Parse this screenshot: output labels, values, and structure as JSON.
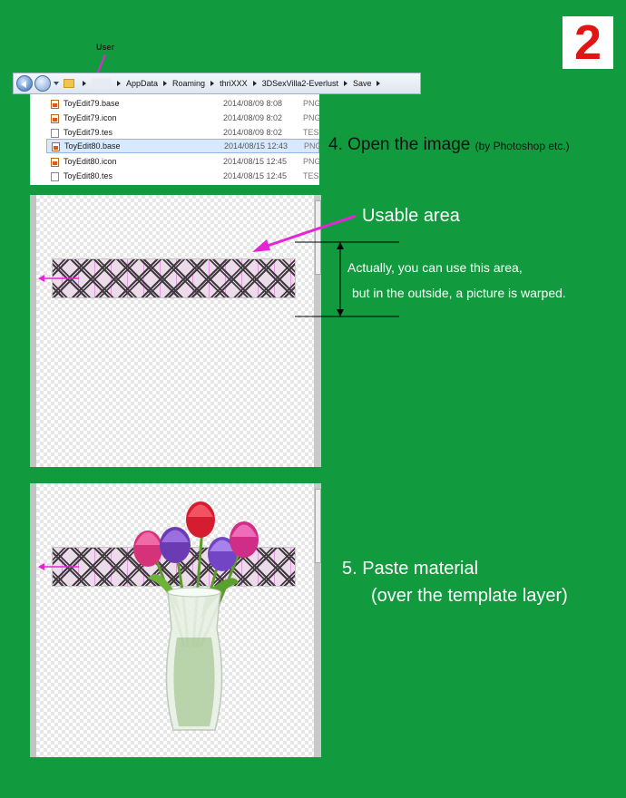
{
  "badge": "2",
  "user_label": "User",
  "breadcrumb": [
    "AppData",
    "Roaming",
    "thriXXX",
    "3DSexVilla2-Everlust",
    "Save"
  ],
  "files": [
    {
      "name": "ToyEdit79.base",
      "date": "2014/08/09 8:08",
      "type": "PNG",
      "icon": "image-file-icon",
      "selected": false
    },
    {
      "name": "ToyEdit79.icon",
      "date": "2014/08/09 8:02",
      "type": "PNG",
      "icon": "image-file-icon",
      "selected": false
    },
    {
      "name": "ToyEdit79.tes",
      "date": "2014/08/09 8:02",
      "type": "TES",
      "icon": "document-file-icon",
      "selected": false
    },
    {
      "name": "ToyEdit80.base",
      "date": "2014/08/15 12:43",
      "type": "PNG",
      "icon": "image-file-icon",
      "selected": true
    },
    {
      "name": "ToyEdit80.icon",
      "date": "2014/08/15 12:45",
      "type": "PNG",
      "icon": "image-file-icon",
      "selected": false
    },
    {
      "name": "ToyEdit80.tes",
      "date": "2014/08/15 12:45",
      "type": "TES",
      "icon": "document-file-icon",
      "selected": false
    }
  ],
  "step4": {
    "title": "4. Open the image",
    "note": "(by Photoshop etc.)"
  },
  "usable": {
    "title": "Usable area",
    "line1": "Actually, you can use this area,",
    "line2": "but in the outside, a picture is warped."
  },
  "step5": {
    "line1": "5. Paste material",
    "line2": "(over the template layer)"
  },
  "colors": {
    "background": "#119b3e",
    "badge_text": "#e31414",
    "arrow": "#e524d6"
  }
}
